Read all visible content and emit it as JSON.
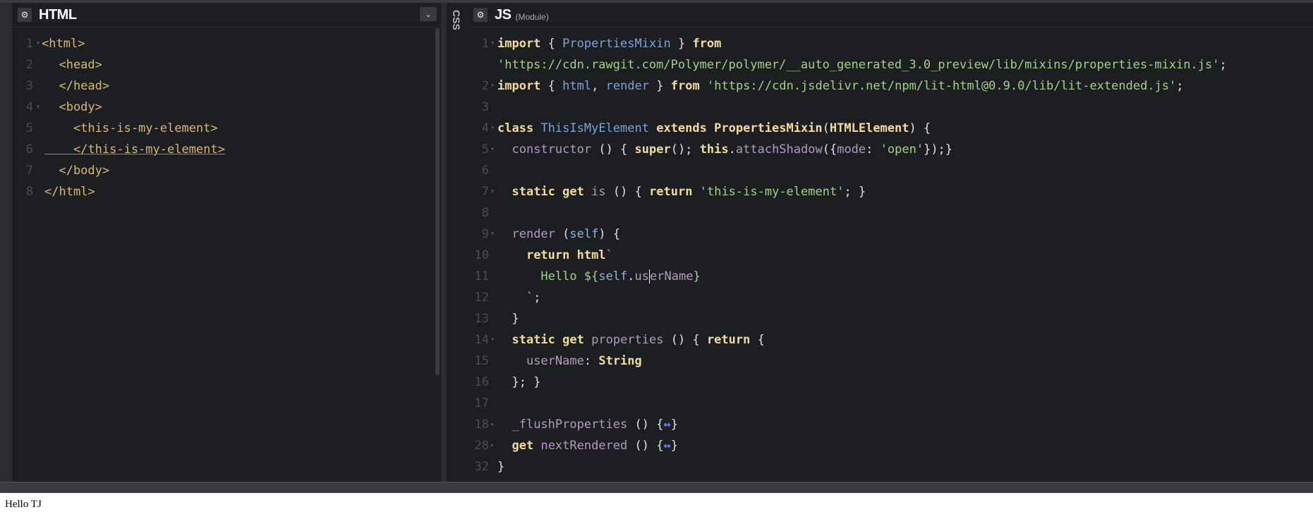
{
  "html_panel": {
    "title": "HTML",
    "gear_icon": "gear-icon",
    "dropdown_icon": "chevron-down-icon",
    "lines": [
      {
        "num": "1",
        "text": "<html>"
      },
      {
        "num": "2",
        "text": "  <head>"
      },
      {
        "num": "3",
        "text": "  </head>"
      },
      {
        "num": "4",
        "text": "  <body>"
      },
      {
        "num": "5",
        "text": "    <this-is-my-element>"
      },
      {
        "num": "6",
        "text": "    </this-is-my-element>"
      },
      {
        "num": "7",
        "text": "  </body>"
      },
      {
        "num": "8",
        "text": "</html>"
      }
    ]
  },
  "css_panel": {
    "title": "CSS"
  },
  "js_panel": {
    "title": "JS",
    "subtitle": "(Module)",
    "gear_icon": "gear-icon",
    "lines": [
      {
        "num": "1",
        "text": "import { PropertiesMixin } from\n'https://cdn.rawgit.com/Polymer/polymer/__auto_generated_3.0_preview/lib/mixins/properties-mixin.js';"
      },
      {
        "num": "2",
        "text": "import { html, render } from 'https://cdn.jsdelivr.net/npm/lit-html@0.9.0/lib/lit-extended.js';"
      },
      {
        "num": "3",
        "text": ""
      },
      {
        "num": "4",
        "text": "class ThisIsMyElement extends PropertiesMixin(HTMLElement) {"
      },
      {
        "num": "5",
        "text": "  constructor () { super(); this.attachShadow({mode: 'open'});}"
      },
      {
        "num": "6",
        "text": ""
      },
      {
        "num": "7",
        "text": "  static get is () { return 'this-is-my-element'; }"
      },
      {
        "num": "8",
        "text": ""
      },
      {
        "num": "9",
        "text": "  render (self) {"
      },
      {
        "num": "10",
        "text": "    return html`"
      },
      {
        "num": "11",
        "text": "      Hello ${self.userName}"
      },
      {
        "num": "12",
        "text": "    `;"
      },
      {
        "num": "13",
        "text": "  }"
      },
      {
        "num": "14",
        "text": "  static get properties () { return {"
      },
      {
        "num": "15",
        "text": "    userName: String"
      },
      {
        "num": "16",
        "text": "  }; }"
      },
      {
        "num": "17",
        "text": ""
      },
      {
        "num": "18",
        "text": "  _flushProperties () {↔}"
      },
      {
        "num": "28",
        "text": "  get nextRendered () {↔}"
      },
      {
        "num": "32",
        "text": "}"
      }
    ]
  },
  "output": {
    "text": "Hello TJ"
  },
  "colors": {
    "editor_bg": "#1d1e22",
    "tag": "#d6b87a",
    "keyword": "#f2dca0",
    "string": "#9fd38a",
    "identifier": "#8fb4da",
    "function": "#b49bbd",
    "fold_marker": "#6c7cff"
  }
}
